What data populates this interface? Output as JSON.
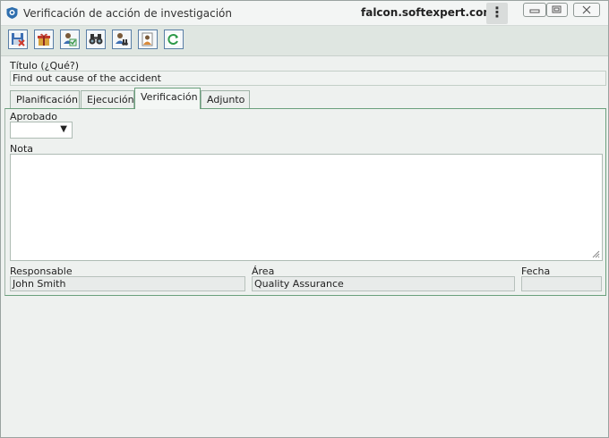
{
  "window": {
    "title": "Verificación de acción de investigación",
    "host": "falcon.softexpert.com",
    "kebab_symbol": "⋮"
  },
  "toolbar": {
    "buttons": [
      {
        "icon": "save-close-icon"
      },
      {
        "icon": "gift-icon"
      },
      {
        "icon": "user-check-icon"
      },
      {
        "icon": "binoculars-icon"
      },
      {
        "icon": "user-search-icon"
      },
      {
        "icon": "user-document-icon"
      },
      {
        "icon": "refresh-icon"
      }
    ]
  },
  "form": {
    "title_label": "Título (¿Qué?)",
    "title_value": "Find out cause of the accident"
  },
  "tabs": [
    {
      "label": "Planificación",
      "active": false
    },
    {
      "label": "Ejecución",
      "active": false
    },
    {
      "label": "Verificación",
      "active": true
    },
    {
      "label": "Adjunto",
      "active": false
    }
  ],
  "verification": {
    "approved_label": "Aprobado",
    "approved_value": "",
    "approved_arrow": "▼",
    "note_label": "Nota",
    "note_value": "",
    "responsible_label": "Responsable",
    "responsible_value": "John Smith",
    "area_label": "Área",
    "area_value": "Quality Assurance",
    "date_label": "Fecha",
    "date_value": ""
  },
  "colors": {
    "accent_green": "#6aa07c",
    "toolbar_bg": "#dfe6e1",
    "button_border": "#5a7fa6"
  }
}
